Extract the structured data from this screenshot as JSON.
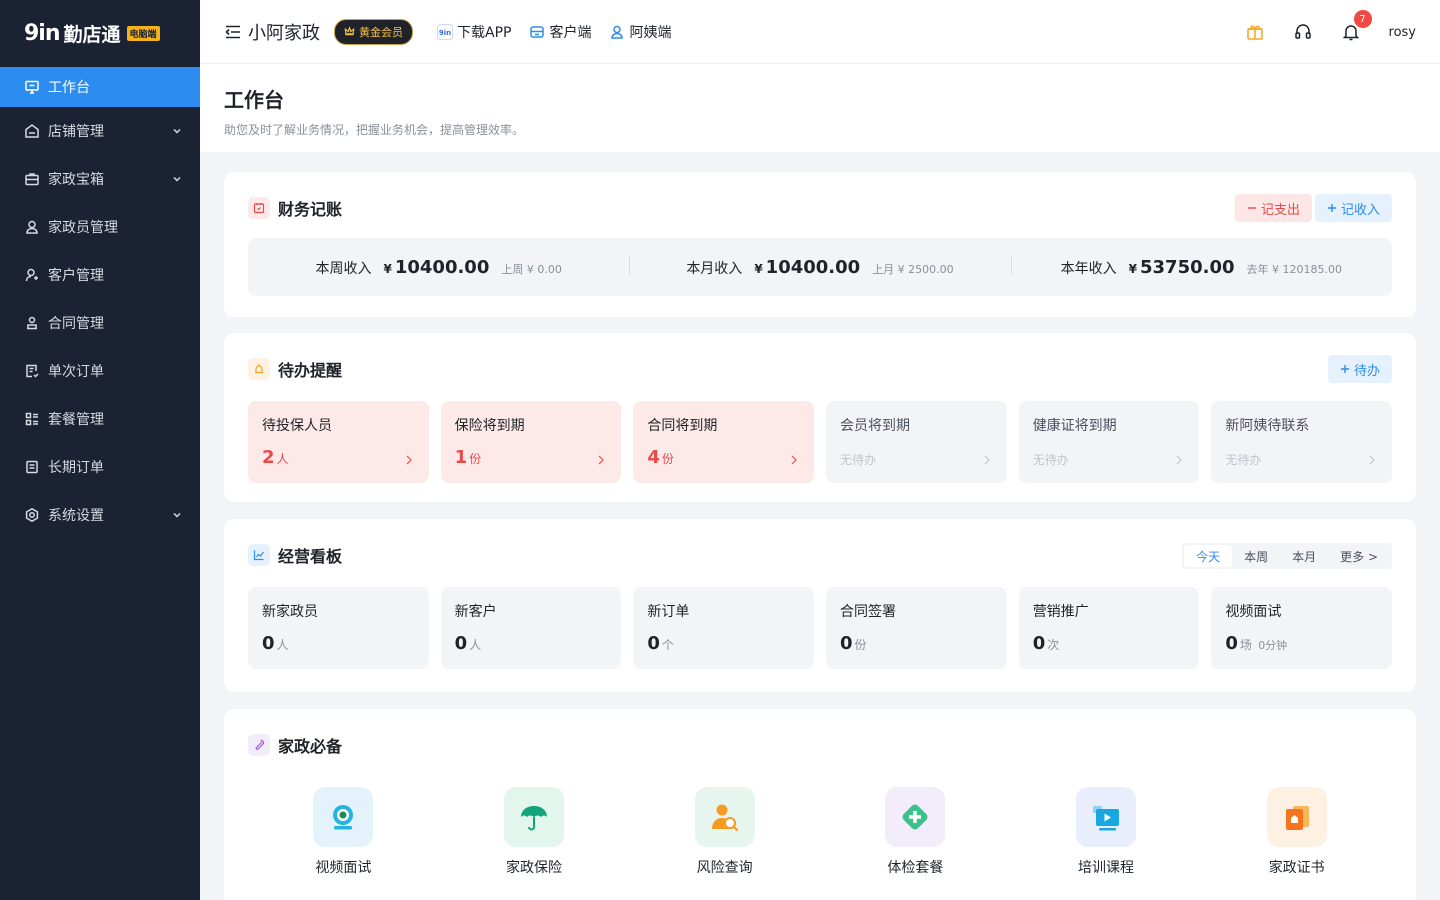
{
  "brand": {
    "mark": "9in",
    "name": "勤店通",
    "badge": "电脑端"
  },
  "sidebar": {
    "items": [
      {
        "label": "工作台",
        "icon": "monitor-icon",
        "active": true,
        "expandable": false
      },
      {
        "label": "店铺管理",
        "icon": "store-icon",
        "active": false,
        "expandable": true
      },
      {
        "label": "家政宝箱",
        "icon": "briefcase-icon",
        "active": false,
        "expandable": true
      },
      {
        "label": "家政员管理",
        "icon": "worker-icon",
        "active": false,
        "expandable": false
      },
      {
        "label": "客户管理",
        "icon": "customer-icon",
        "active": false,
        "expandable": false
      },
      {
        "label": "合同管理",
        "icon": "contract-icon",
        "active": false,
        "expandable": false
      },
      {
        "label": "单次订单",
        "icon": "order-icon",
        "active": false,
        "expandable": false
      },
      {
        "label": "套餐管理",
        "icon": "package-icon",
        "active": false,
        "expandable": false
      },
      {
        "label": "长期订单",
        "icon": "long-order-icon",
        "active": false,
        "expandable": false
      },
      {
        "label": "系统设置",
        "icon": "settings-icon",
        "active": false,
        "expandable": true
      }
    ]
  },
  "topbar": {
    "shop_name": "小阿家政",
    "vip_label": "黄金会员",
    "links": {
      "download": "下载APP",
      "client": "客户端",
      "aunt": "阿姨端"
    },
    "notification_count": "7",
    "username": "rosy"
  },
  "page": {
    "title": "工作台",
    "desc": "助您及时了解业务情况，把握业务机会，提高管理效率。"
  },
  "finance": {
    "title": "财务记账",
    "expense_btn": "记支出",
    "income_btn": "记收入",
    "currency": "¥",
    "stats": [
      {
        "label": "本周收入",
        "value": "10400.00",
        "prev": "上周 ¥ 0.00"
      },
      {
        "label": "本月收入",
        "value": "10400.00",
        "prev": "上月 ¥ 2500.00"
      },
      {
        "label": "本年收入",
        "value": "53750.00",
        "prev": "去年 ¥ 120185.00"
      }
    ]
  },
  "todo": {
    "title": "待办提醒",
    "add_btn": "待办",
    "empty_text": "无待办",
    "items": [
      {
        "label": "待投保人员",
        "value": "2",
        "unit": "人"
      },
      {
        "label": "保险将到期",
        "value": "1",
        "unit": "份"
      },
      {
        "label": "合同将到期",
        "value": "4",
        "unit": "份"
      },
      {
        "label": "会员将到期"
      },
      {
        "label": "健康证将到期"
      },
      {
        "label": "新阿姨待联系"
      }
    ]
  },
  "board": {
    "title": "经营看板",
    "ranges": [
      "今天",
      "本周",
      "本月",
      "更多 >"
    ],
    "stats": [
      {
        "label": "新家政员",
        "value": "0",
        "unit": "人",
        "sub": ""
      },
      {
        "label": "新客户",
        "value": "0",
        "unit": "人",
        "sub": ""
      },
      {
        "label": "新订单",
        "value": "0",
        "unit": "个",
        "sub": ""
      },
      {
        "label": "合同签署",
        "value": "0",
        "unit": "份",
        "sub": ""
      },
      {
        "label": "营销推广",
        "value": "0",
        "unit": "次",
        "sub": ""
      },
      {
        "label": "视频面试",
        "value": "0",
        "unit": "场",
        "sub": "0分钟"
      }
    ]
  },
  "tools": {
    "title": "家政必备",
    "items": [
      {
        "label": "视频面试",
        "icon": "video-interview-icon",
        "bg": "#e4f3fb"
      },
      {
        "label": "家政保险",
        "icon": "umbrella-icon",
        "bg": "#e3f6ee"
      },
      {
        "label": "风险查询",
        "icon": "risk-search-icon",
        "bg": "#e6f6ef"
      },
      {
        "label": "体检套餐",
        "icon": "medical-plus-icon",
        "bg": "#f3ecfb"
      },
      {
        "label": "培训课程",
        "icon": "training-video-icon",
        "bg": "#e9eefc"
      },
      {
        "label": "家政证书",
        "icon": "certificate-icon",
        "bg": "#fdf1e4"
      }
    ]
  }
}
